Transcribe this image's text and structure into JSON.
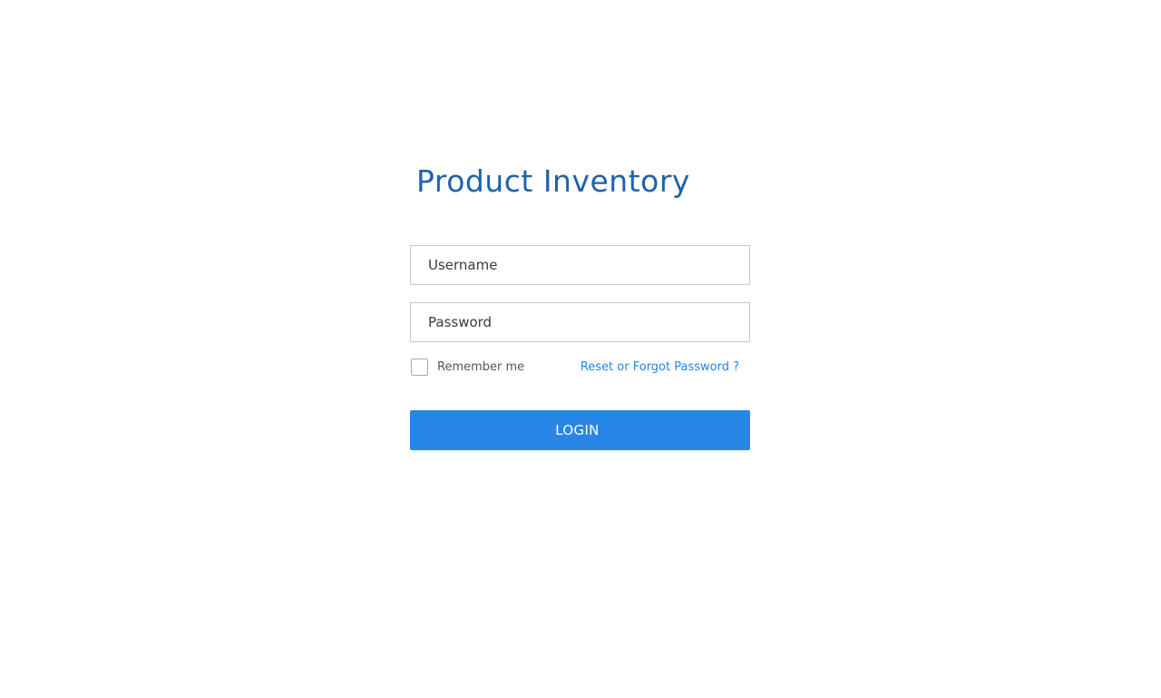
{
  "app": {
    "title": "Product Inventory"
  },
  "form": {
    "username": {
      "value": "",
      "placeholder": "Username"
    },
    "password": {
      "value": "",
      "placeholder": "Password"
    },
    "remember_me": {
      "label": "Remember me",
      "checked": false
    },
    "forgot_link": "Reset or Forgot Password ?",
    "login_label": "LOGIN"
  },
  "colors": {
    "title": "#1f63a9",
    "link": "#2684e4",
    "button_bg": "#2786e6",
    "button_text": "#ffffff",
    "field_border": "#c7c7c7"
  }
}
